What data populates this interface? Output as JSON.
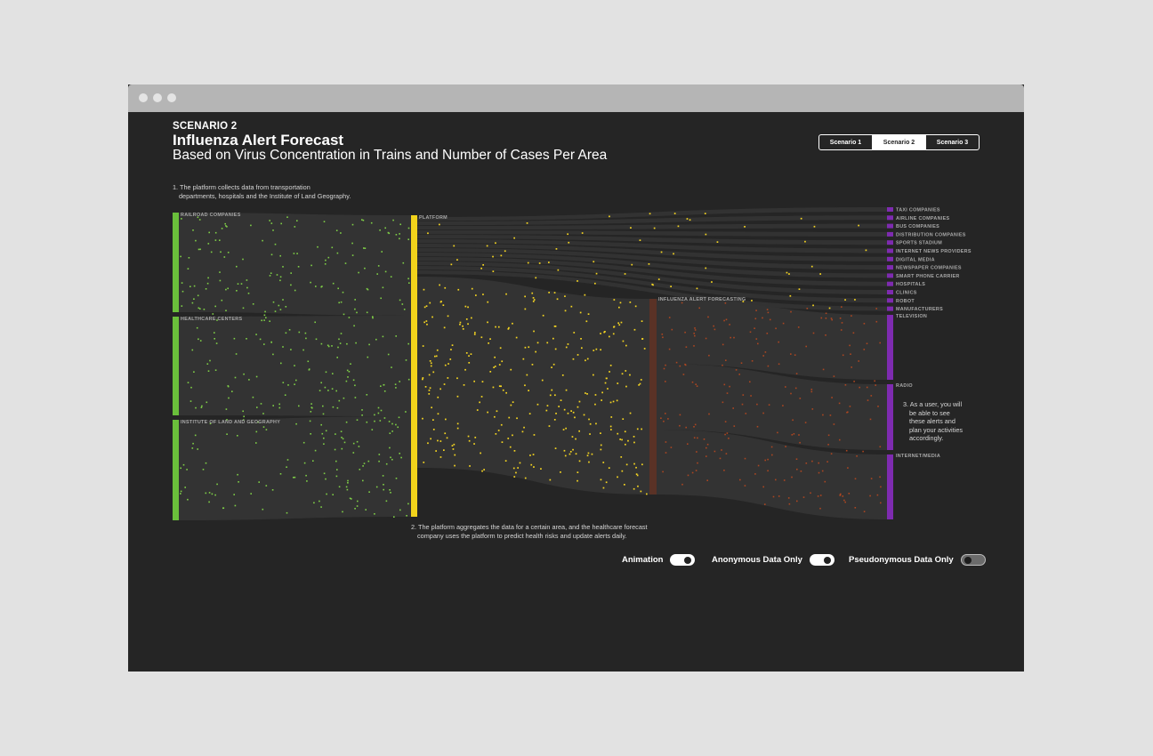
{
  "window": {
    "dots": 3
  },
  "header": {
    "kicker": "SCENARIO 2",
    "title": "Influenza Alert Forecast",
    "subtitle": "Based on Virus Concentration in Trains and Number of Cases Per Area"
  },
  "tabs": [
    {
      "label": "Scenario 1",
      "active": false
    },
    {
      "label": "Scenario 2",
      "active": true
    },
    {
      "label": "Scenario 3",
      "active": false
    }
  ],
  "notes": {
    "step1": {
      "line1": "1. The platform collects data from transportation",
      "line2": "departments, hospitals and the Institute of Land Geography."
    },
    "step2": {
      "line1": "2. The platform aggregates the data for a certain area, and the healthcare forecast",
      "line2": "company uses the platform to predict health risks and update alerts daily."
    },
    "step3": {
      "line1": "3. As a user, you will",
      "line2": "be able to see",
      "line3": "these alerts and",
      "line4": "plan your activities",
      "line5": "accordingly."
    }
  },
  "colors": {
    "sources": "#6abf3b",
    "platform": "#f2d31b",
    "forecasting": "#5a3226",
    "destinations": "#7e2bb0",
    "flow": "#333333",
    "dot_sources": "#7fcf47",
    "dot_platform": "#f5d521",
    "dot_forecasting": "#b8481f",
    "background": "#252525"
  },
  "diagram": {
    "sources": [
      {
        "label": "RAILROAD COMPANIES"
      },
      {
        "label": "HEALTHCARE CENTERS"
      },
      {
        "label": "INSTITUTE OF LAND AND GEOGRAPHY"
      }
    ],
    "platform": {
      "label": "PLATFORM"
    },
    "forecasting": {
      "label": "INFLUENZA ALERT FORECASTING"
    },
    "destinations": [
      {
        "label": "TAXI COMPANIES"
      },
      {
        "label": "AIRLINE COMPANIES"
      },
      {
        "label": "BUS COMPANIES"
      },
      {
        "label": "DISTRIBUTION COMPANIES"
      },
      {
        "label": "SPORTS STADIUM"
      },
      {
        "label": "INTERNET NEWS PROVIDERS"
      },
      {
        "label": "DIGITAL MEDIA"
      },
      {
        "label": "NEWSPAPER COMPANIES"
      },
      {
        "label": "SMART PHONE CARRIER"
      },
      {
        "label": "HOSPITALS"
      },
      {
        "label": "CLINICS"
      },
      {
        "label": "ROBOT"
      },
      {
        "label": "MANUFACTURERS"
      },
      {
        "label": "TELEVISION"
      },
      {
        "label": "RADIO"
      },
      {
        "label": "INTERNET/MEDIA"
      }
    ]
  },
  "controls": [
    {
      "label": "Animation",
      "on": true
    },
    {
      "label": "Anonymous Data Only",
      "on": true
    },
    {
      "label": "Pseudonymous Data Only",
      "on": false
    }
  ]
}
